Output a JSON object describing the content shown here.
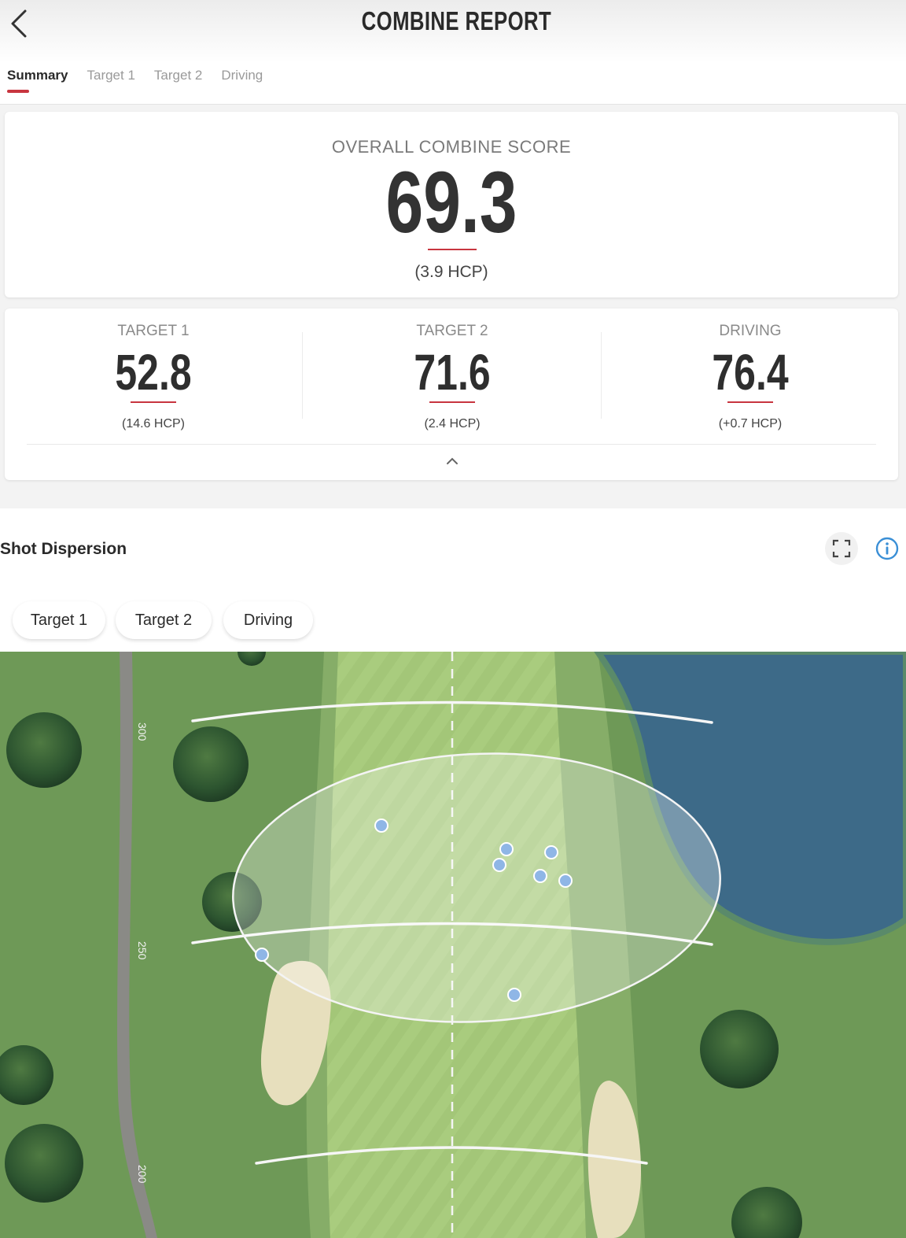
{
  "header": {
    "title": "COMBINE REPORT",
    "tabs": [
      "Summary",
      "Target 1",
      "Target 2",
      "Driving"
    ],
    "active_tab": "Summary"
  },
  "overall": {
    "label": "OVERALL COMBINE SCORE",
    "score": "69.3",
    "hcp": "(3.9 HCP)"
  },
  "sub_scores": [
    {
      "label": "TARGET 1",
      "score": "52.8",
      "hcp": "(14.6 HCP)"
    },
    {
      "label": "TARGET 2",
      "score": "71.6",
      "hcp": "(2.4 HCP)"
    },
    {
      "label": "DRIVING",
      "score": "76.4",
      "hcp": "(+0.7 HCP)"
    }
  ],
  "shot_dispersion": {
    "title": "Shot Dispersion",
    "filters": [
      "Target 1",
      "Target 2",
      "Driving"
    ],
    "yardage_markers": [
      "300",
      "250",
      "200"
    ],
    "shot_count": 9
  },
  "colors": {
    "accent": "#c8353f",
    "info": "#3a8fd6",
    "fairway": "#a9cc7c",
    "rough": "#6f9a58",
    "water": "#3d6a88",
    "sand": "#e7dfbd",
    "shot_dot": "#8fb6e6"
  },
  "icons": [
    "back-arrow-icon",
    "chevron-up-icon",
    "expand-icon",
    "info-icon"
  ]
}
